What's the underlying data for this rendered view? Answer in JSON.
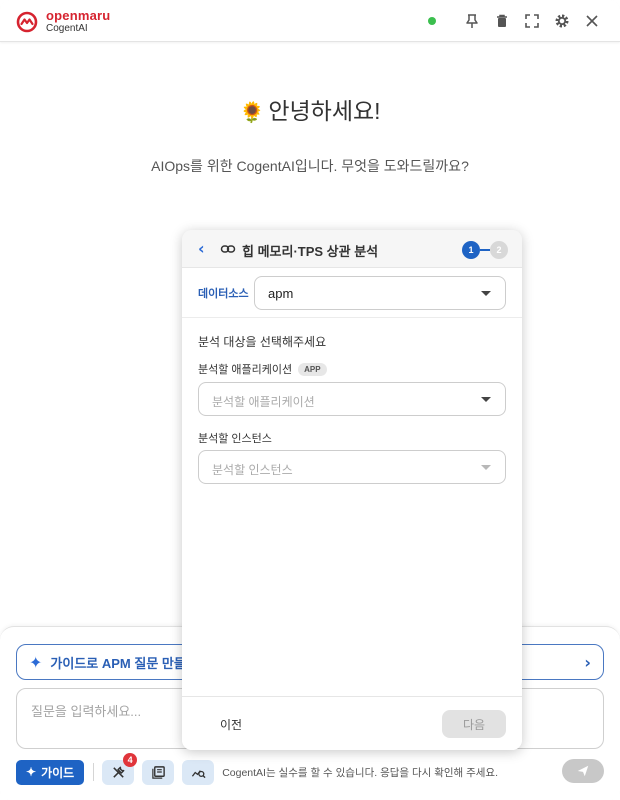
{
  "app": {
    "brand": "openmaru",
    "product": "CogentAI",
    "brand_color": "#d6232f",
    "accent_color": "#1e63c4",
    "status": "online",
    "status_color": "#3bbf4e"
  },
  "header": {
    "actions": [
      "pin-icon",
      "trash-icon",
      "fullscreen-icon",
      "gear-icon",
      "close-icon"
    ]
  },
  "welcome": {
    "emoji": "🌻",
    "title": "안녕하세요!",
    "subtitle": "AIOps를 위한 CogentAI입니다. 무엇을 도와드릴까요?"
  },
  "wizard": {
    "title": "힙 메모리·TPS 상관 분석",
    "steps": [
      "1",
      "2"
    ],
    "current_step": 1,
    "datasource": {
      "label": "데이터소스",
      "value": "apm"
    },
    "section_title": "분석 대상을 선택해주세요",
    "application": {
      "label": "분석할 애플리케이션",
      "tag": "APP",
      "placeholder": "분석할 애플리케이션"
    },
    "instance": {
      "label": "분석할 인스턴스",
      "placeholder": "분석할 인스턴스"
    },
    "prev_label": "이전",
    "next_label": "다음"
  },
  "composer": {
    "guide_banner": "가이드로 APM 질문 만들기",
    "input_placeholder": "질문을 입력하세요...",
    "guide_button": "가이드",
    "tools_badge": "4",
    "disclaimer": "CogentAI는 실수를 할 수 있습니다. 응답을 다시 확인해 주세요."
  }
}
